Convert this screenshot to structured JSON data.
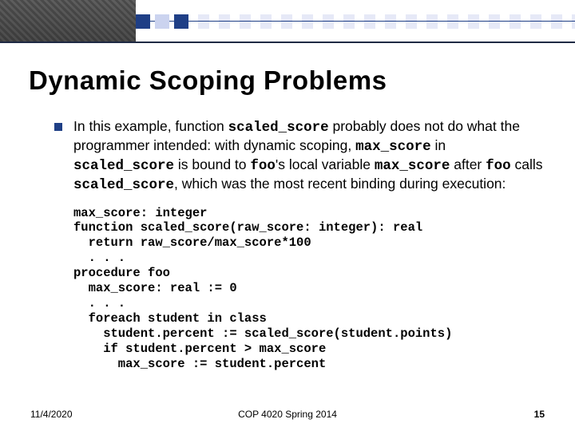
{
  "title": "Dynamic Scoping Problems",
  "para": {
    "t1": "In this example, function ",
    "c1": "scaled_score",
    "t2": " probably does not do what the programmer intended: with dynamic scoping, ",
    "c2": "max_score",
    "t3": " in ",
    "c3": "scaled_score",
    "t4": " is bound to ",
    "c4": "foo",
    "t5": "'s local variable ",
    "c5": "max_score",
    "t6": " after ",
    "c6": "foo",
    "t7": " calls ",
    "c7": "scaled_score",
    "t8": ", which was the most recent binding during execution:"
  },
  "code": "max_score: integer\nfunction scaled_score(raw_score: integer): real\n  return raw_score/max_score*100\n  . . .\nprocedure foo\n  max_score: real := 0\n  . . .\n  foreach student in class\n    student.percent := scaled_score(student.points)\n    if student.percent > max_score\n      max_score := student.percent",
  "footer": {
    "date": "11/4/2020",
    "course": "COP 4020 Spring 2014",
    "page": "15"
  }
}
